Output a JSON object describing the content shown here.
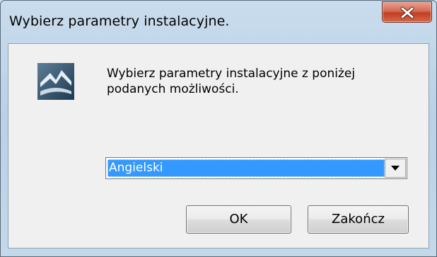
{
  "window": {
    "title": "Wybierz parametry instalacyjne."
  },
  "icons": {
    "close": "close-icon",
    "app": "installer-app-icon",
    "dropdown": "chevron-down-icon"
  },
  "dialog": {
    "prompt": "Wybierz parametry instalacyjne z poniżej\npodanych możliwości.",
    "language_select": {
      "selected": "Angielski"
    },
    "buttons": {
      "ok_label": "OK",
      "exit_label": "Zakończ"
    }
  },
  "colors": {
    "selection": "#3399ff",
    "close_button": "#c23e22",
    "client_background": "#f0f0f0"
  }
}
